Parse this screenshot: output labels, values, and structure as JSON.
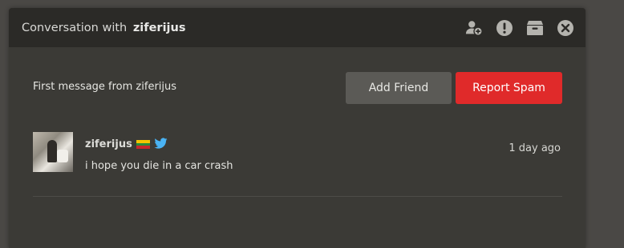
{
  "header": {
    "title_prefix": "Conversation with",
    "username": "ziferijus",
    "icons": [
      "add-user-icon",
      "alert-icon",
      "archive-icon",
      "close-icon"
    ]
  },
  "notice": {
    "text": "First message from ziferijus",
    "add_friend_label": "Add Friend",
    "report_spam_label": "Report Spam"
  },
  "message": {
    "sender": "ziferijus",
    "badges": [
      "lithuania-flag-icon",
      "twitter-bird-icon"
    ],
    "text": "i hope you die in a car crash",
    "time": "1 day ago"
  },
  "colors": {
    "panel_bg": "#3b3a36",
    "header_bg": "#2b2a27",
    "spam_red": "#e02a2a",
    "friend_gray": "#5b5a56"
  }
}
